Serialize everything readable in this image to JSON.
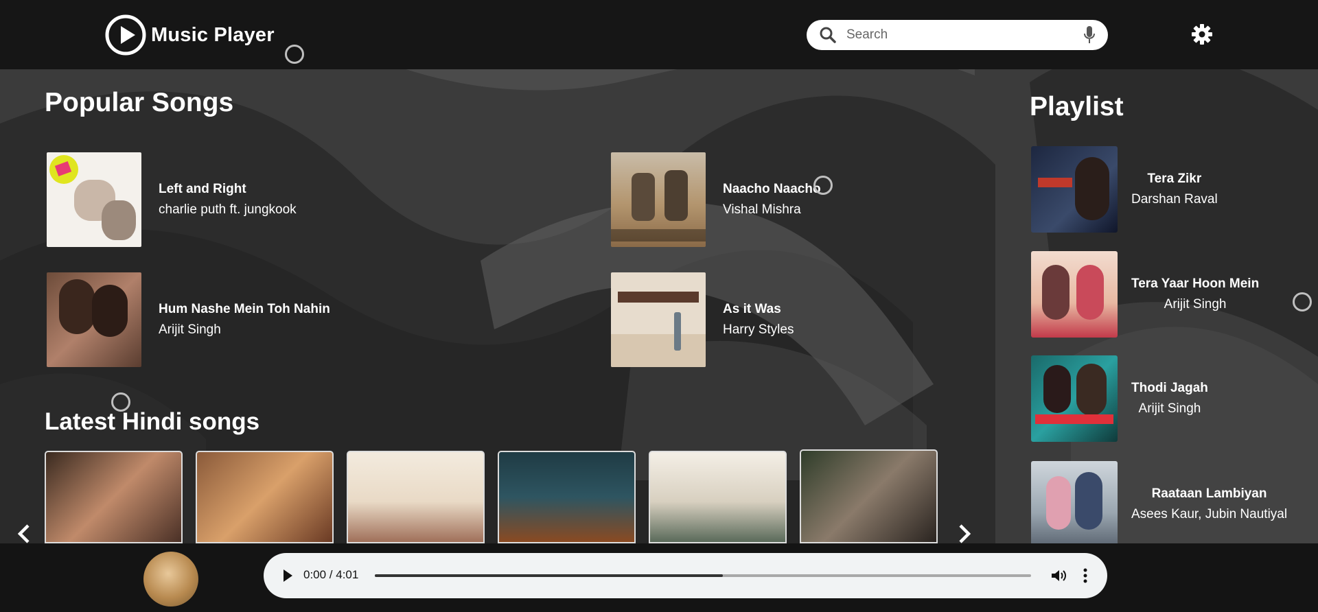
{
  "app": {
    "title": "Music Player"
  },
  "search": {
    "placeholder": "Search"
  },
  "popular": {
    "title": "Popular Songs",
    "songs": [
      {
        "title": "Left and Right",
        "artist": "charlie puth ft. jungkook"
      },
      {
        "title": "Naacho Naacho",
        "artist": "Vishal Mishra"
      },
      {
        "title": "Hum Nashe Mein Toh Nahin",
        "artist": "Arijit Singh"
      },
      {
        "title": "As it Was",
        "artist": "Harry Styles"
      }
    ]
  },
  "latest": {
    "title": "Latest Hindi songs"
  },
  "playlist": {
    "title": "Playlist",
    "items": [
      {
        "title": "Tera Zikr",
        "artist": "Darshan Raval"
      },
      {
        "title": "Tera Yaar Hoon Mein",
        "artist": "Arijit Singh"
      },
      {
        "title": "Thodi Jagah",
        "artist": "Arijit Singh"
      },
      {
        "title": "Raataan Lambiyan",
        "artist": "Asees Kaur, Jubin Nautiyal"
      }
    ]
  },
  "player": {
    "time": "0:00 / 4:01",
    "progress": 0.53
  },
  "colors": {
    "topbar": "#161616",
    "background": "#3a3a3a",
    "player_bar": "#141414",
    "audio_control": "#f1f3f4"
  },
  "icons": [
    "play-circle-icon",
    "search-icon",
    "microphone-icon",
    "gear-icon",
    "chevron-left-icon",
    "chevron-right-icon",
    "play-icon",
    "volume-icon",
    "more-vertical-icon"
  ]
}
